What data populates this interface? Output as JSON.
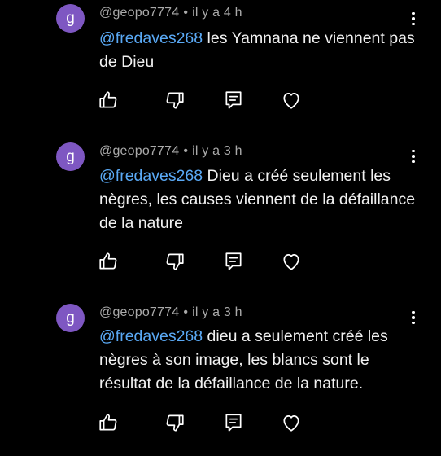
{
  "comments": [
    {
      "avatar_letter": "g",
      "author": "@geopo7774",
      "separator": "•",
      "time": "il y a 4 h",
      "mention": "@fredaves268",
      "text": " les Yamnana ne viennent pas de Dieu"
    },
    {
      "avatar_letter": "g",
      "author": "@geopo7774",
      "separator": "•",
      "time": "il y a 3 h",
      "mention": "@fredaves268",
      "text": " Dieu a créé seulement les nègres, les causes viennent de la défaillance de la nature"
    },
    {
      "avatar_letter": "g",
      "author": "@geopo7774",
      "separator": "•",
      "time": "il y a 3 h",
      "mention": "@fredaves268",
      "text": " dieu a seulement créé les nègres à son image, les blancs sont le résultat de la défaillance de la nature."
    }
  ],
  "action_icons": [
    "thumbs-up-icon",
    "thumbs-down-icon",
    "reply-icon",
    "heart-icon"
  ],
  "menu_icon": "more-vertical-icon",
  "colors": {
    "background": "#000000",
    "avatar": "#7e57c2",
    "mention": "#5aa9f5",
    "meta": "#aaaaaa",
    "text": "#f1f1f1"
  }
}
